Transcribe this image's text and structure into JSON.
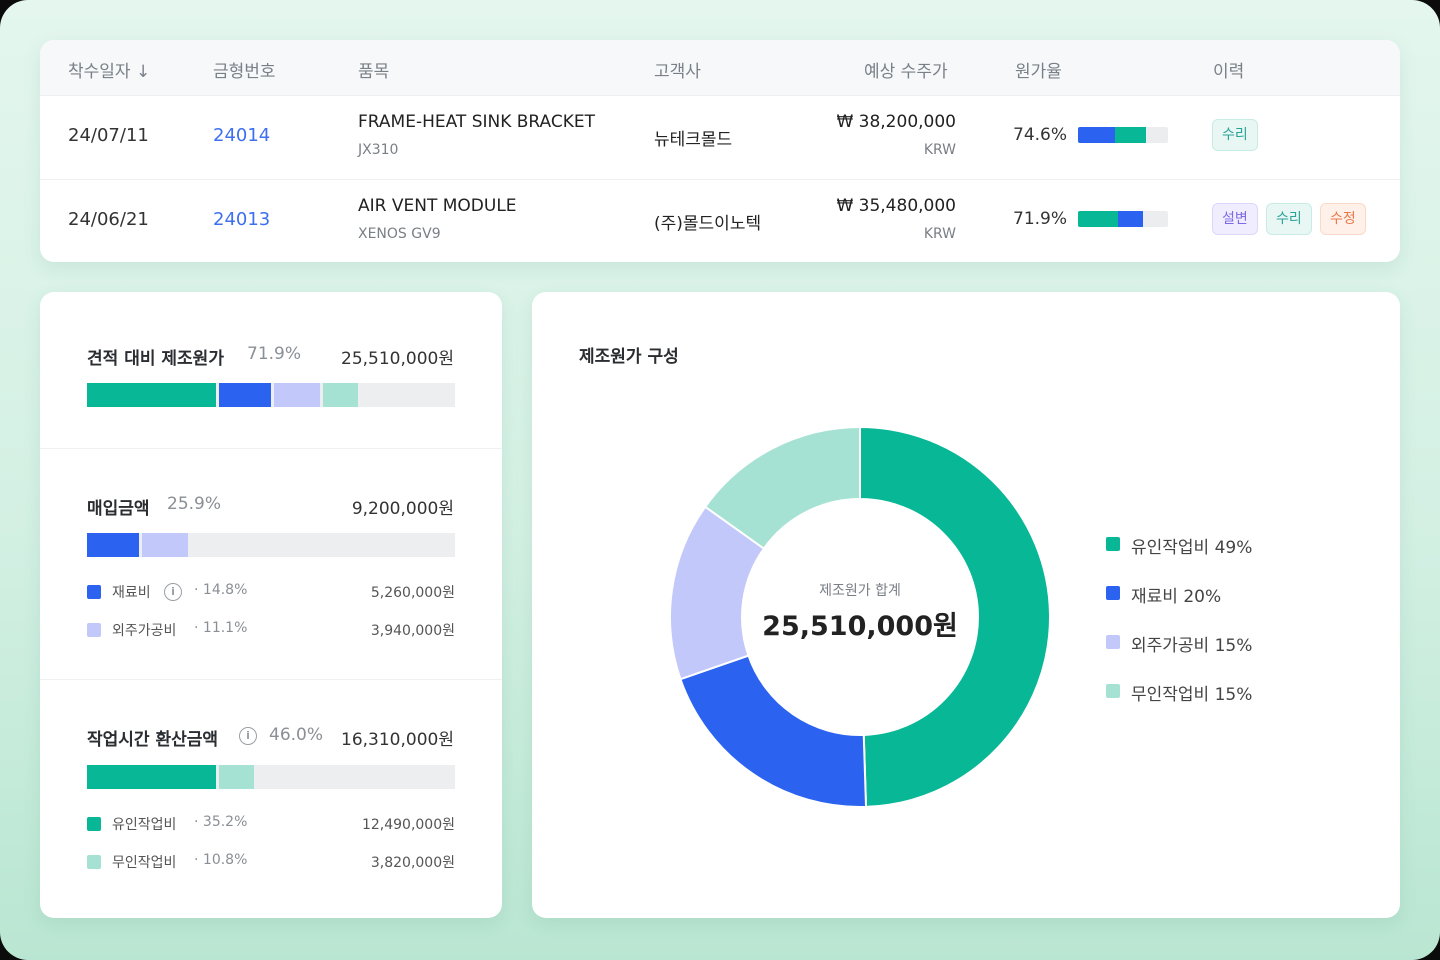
{
  "colors": {
    "green": "#07b795",
    "blue": "#2b63f0",
    "lavender": "#c3c8fa",
    "mint": "#a6e2d4",
    "track": "#eceef0"
  },
  "table": {
    "headers": {
      "date": "착수일자 ↓",
      "code": "금형번호",
      "item": "품목",
      "customer": "고객사",
      "price": "예상 수주가",
      "cost_rate": "원가율",
      "history": "이력"
    },
    "rows": [
      {
        "date": "24/07/11",
        "code": "24014",
        "item_name": "FRAME-HEAT SINK BRACKET",
        "item_sub": "JX310",
        "customer": "뉴테크몰드",
        "price": "₩ 38,200,000",
        "currency": "KRW",
        "cost_rate": "74.6%",
        "rate_bar": [
          {
            "color": "#2b63f0",
            "share": 0.41
          },
          {
            "color": "#07b795",
            "share": 0.34
          }
        ],
        "history": [
          "수리"
        ]
      },
      {
        "date": "24/06/21",
        "code": "24013",
        "item_name": "AIR VENT MODULE",
        "item_sub": "XENOS GV9",
        "customer": "(주)몰드이노텍",
        "price": "₩ 35,480,000",
        "currency": "KRW",
        "cost_rate": "71.9%",
        "rate_bar": [
          {
            "color": "#07b795",
            "share": 0.44
          },
          {
            "color": "#2b63f0",
            "share": 0.28
          }
        ],
        "history": [
          "설변",
          "수리",
          "수정"
        ]
      }
    ]
  },
  "summary": {
    "total": {
      "title": "견적 대비 제조원가",
      "pct": "71.9%",
      "amount": "25,510,000원",
      "bar": [
        0.35,
        0.14,
        0.125,
        0.095
      ]
    },
    "purchase": {
      "title": "매입금액",
      "pct": "25.9%",
      "amount": "9,200,000원",
      "bar": [
        0.14,
        0.125
      ],
      "items": [
        {
          "label": "재료비",
          "pct": "14.8%",
          "amount": "5,260,000원",
          "color": "#2b63f0",
          "info": "i"
        },
        {
          "label": "외주가공비",
          "pct": "11.1%",
          "amount": "3,940,000원",
          "color": "#c3c8fa"
        }
      ]
    },
    "labor": {
      "title": "작업시간 환산금액",
      "pct": "46.0%",
      "amount": "16,310,000원",
      "info": "i",
      "bar": [
        0.35,
        0.095
      ],
      "items": [
        {
          "label": "유인작업비",
          "pct": "35.2%",
          "amount": "12,490,000원",
          "color": "#07b795"
        },
        {
          "label": "무인작업비",
          "pct": "10.8%",
          "amount": "3,820,000원",
          "color": "#a6e2d4"
        }
      ]
    }
  },
  "chart_data": {
    "type": "pie",
    "title": "제조원가 구성",
    "center_label": "제조원가 합계",
    "center_value": "25,510,000원",
    "donut": true,
    "series": [
      {
        "name": "유인작업비",
        "value": 49,
        "label": "유인작업비 49%",
        "color": "#07b795"
      },
      {
        "name": "재료비",
        "value": 20,
        "label": "재료비 20%",
        "color": "#2b63f0"
      },
      {
        "name": "외주가공비",
        "value": 15,
        "label": "외주가공비 15%",
        "color": "#c3c8fa"
      },
      {
        "name": "무인작업비",
        "value": 15,
        "label": "무인작업비 15%",
        "color": "#a6e2d4"
      }
    ],
    "legend": "right"
  }
}
